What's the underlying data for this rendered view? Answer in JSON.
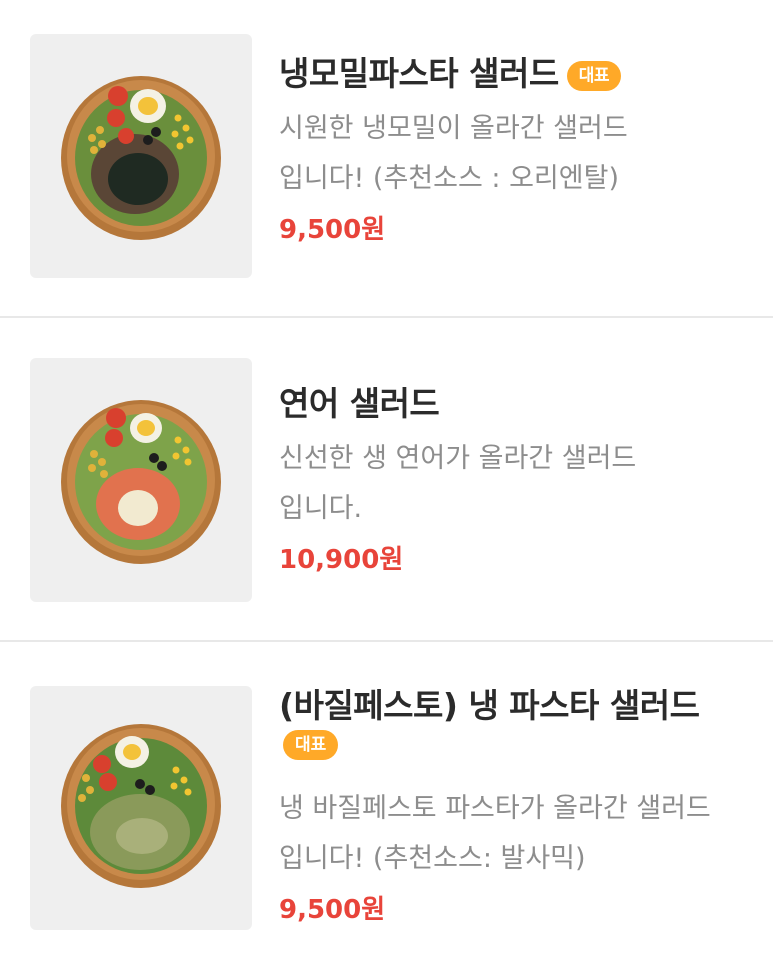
{
  "menu": {
    "items": [
      {
        "name": "냉모밀파스타 샐러드",
        "badge": "대표",
        "description": "시원한 냉모밀이 올라간 샐러드 입니다! (추천소스 : 오리엔탈)",
        "price": "9,500원"
      },
      {
        "name": "연어 샐러드",
        "description": "신선한 생 연어가 올라간 샐러드 입니다.",
        "price": "10,900원"
      },
      {
        "name": "(바질페스토) 냉 파스타 샐러드",
        "badge": "대표",
        "description": "냉 바질페스토 파스타가 올라간 샐러드 입니다! (추천소스: 발사믹)",
        "price": "9,500원"
      }
    ]
  },
  "colors": {
    "badge": "#ffa928",
    "price": "#e8443a",
    "description": "#8d8d8d",
    "name": "#2b2b2b",
    "thumb_bg": "#efefef"
  }
}
